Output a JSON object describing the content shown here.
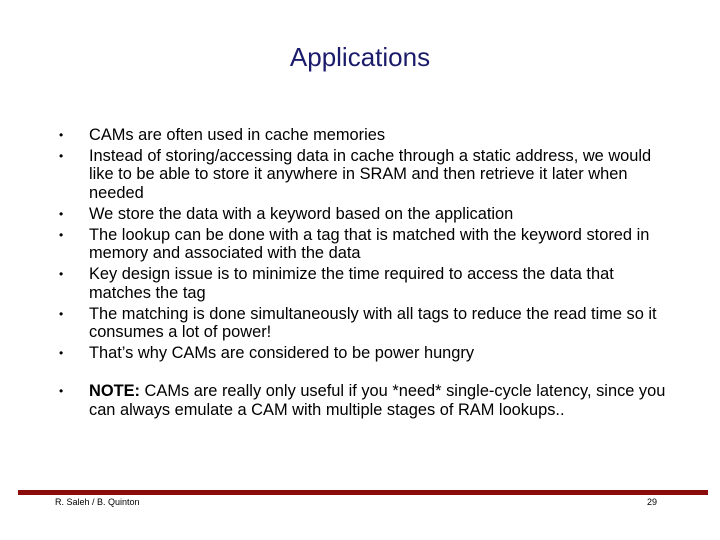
{
  "slide": {
    "title": "Applications",
    "bullets": [
      "CAMs are often used in cache memories",
      "Instead of storing/accessing data in cache through a static address, we would like to be able to store it anywhere in SRAM and then retrieve it later when needed",
      "We store the data with a keyword based on the application",
      "The lookup can be done with a tag that is matched with the keyword stored in memory and associated with the data",
      "Key design issue is to minimize the time required to access the data that matches the tag",
      "The matching is done simultaneously with all tags to reduce the read time so it consumes a lot of power!",
      "That’s why CAMs are considered to be power hungry"
    ],
    "note": {
      "label": "NOTE:",
      "text": " CAMs are really only useful if you *need* single-cycle latency, since you can always emulate a  CAM with multiple stages of RAM lookups.."
    },
    "bullet_glyph": "•"
  },
  "footer": {
    "author": "R. Saleh / B. Quinton",
    "page_number": "29",
    "bar_color": "#8b0a0a"
  },
  "colors": {
    "title": "#1b1b6b",
    "body_text": "#000000",
    "background": "#ffffff"
  }
}
